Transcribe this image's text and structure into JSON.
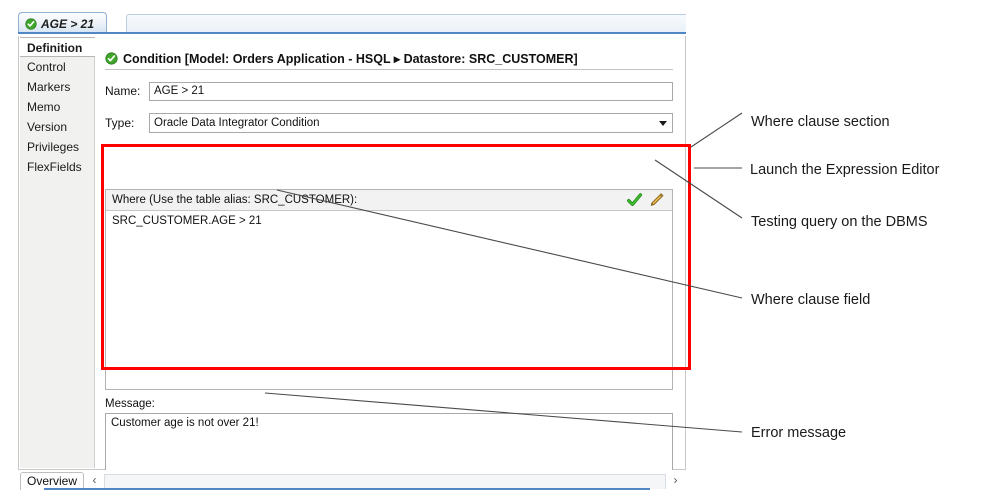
{
  "window": {
    "document_tab": {
      "label": "AGE > 21",
      "icon": "green-check-circle-icon"
    }
  },
  "sidebar": {
    "items": [
      {
        "label": "Definition",
        "selected": true
      },
      {
        "label": "Control",
        "selected": false
      },
      {
        "label": "Markers",
        "selected": false
      },
      {
        "label": "Memo",
        "selected": false
      },
      {
        "label": "Version",
        "selected": false
      },
      {
        "label": "Privileges",
        "selected": false
      },
      {
        "label": "FlexFields",
        "selected": false
      }
    ]
  },
  "definition": {
    "heading": "Condition [Model: Orders Application - HSQL ▸ Datastore: SRC_CUSTOMER]",
    "heading_icon": "green-check-circle-icon",
    "name_label": "Name:",
    "name_value": "AGE > 21",
    "type_label": "Type:",
    "type_value": "Oracle Data Integrator Condition",
    "where_header": "Where (Use the table alias: SRC_CUSTOMER):",
    "where_value": "SRC_CUSTOMER.AGE > 21",
    "tool_check": "green-check-icon",
    "tool_pencil": "pencil-edit-icon",
    "message_label": "Message:",
    "message_value": "Customer age is not over 21!"
  },
  "bottom_bar": {
    "overview_tab": "Overview",
    "scroll_left": "‹",
    "scroll_right": "›"
  },
  "annotations": [
    {
      "text": "Where clause section"
    },
    {
      "text": "Launch the Expression Editor"
    },
    {
      "text": "Testing query on the DBMS"
    },
    {
      "text": "Where clause field"
    },
    {
      "text": "Error message"
    }
  ],
  "colors": {
    "callout": "#ff0000",
    "accent_blue": "#5187c4",
    "status_green": "#3a9c23",
    "pencil_orange": "#e8a33d"
  }
}
